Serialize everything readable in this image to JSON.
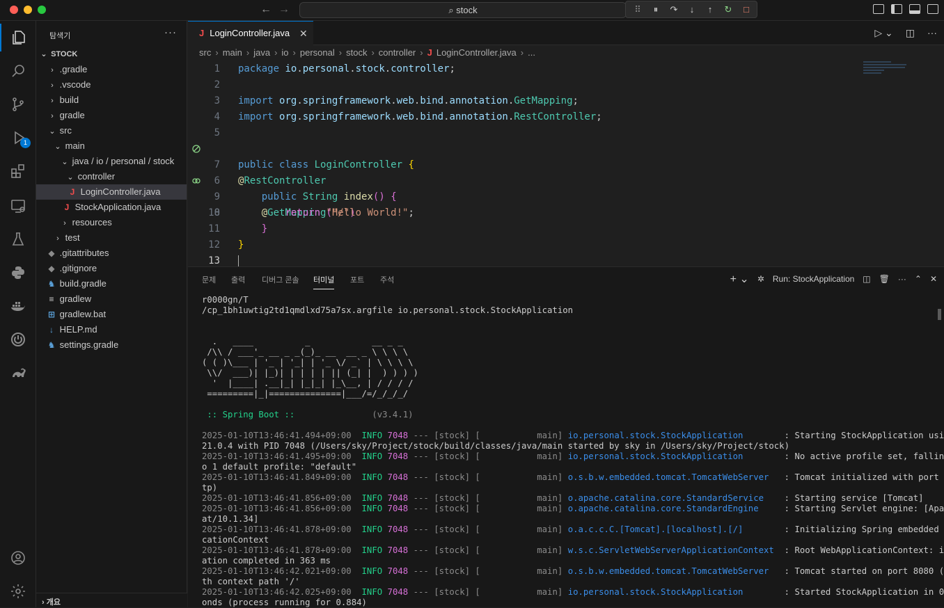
{
  "titlebar": {
    "search_text": "stock",
    "colors": {
      "close": "#ff5f57",
      "minimize": "#febc2e",
      "maximize": "#28c840"
    }
  },
  "activity": {
    "debug_badge": "1"
  },
  "sidebar": {
    "title": "탐색기",
    "more": "···",
    "root": "STOCK",
    "items": [
      {
        "label": ".gradle"
      },
      {
        "label": ".vscode"
      },
      {
        "label": "build"
      },
      {
        "label": "gradle"
      },
      {
        "label": "src"
      },
      {
        "label": "main"
      },
      {
        "label": "java / io / personal / stock"
      },
      {
        "label": "controller"
      },
      {
        "label": "LoginController.java"
      },
      {
        "label": "StockApplication.java"
      },
      {
        "label": "resources"
      },
      {
        "label": "test"
      },
      {
        "label": ".gitattributes"
      },
      {
        "label": ".gitignore"
      },
      {
        "label": "build.gradle"
      },
      {
        "label": "gradlew"
      },
      {
        "label": "gradlew.bat"
      },
      {
        "label": "HELP.md"
      },
      {
        "label": "settings.gradle"
      }
    ],
    "outline": "개요"
  },
  "editor": {
    "tab_label": "LoginController.java",
    "breadcrumb": [
      "src",
      "main",
      "java",
      "io",
      "personal",
      "stock",
      "controller",
      "LoginController.java",
      "..."
    ],
    "line_numbers": [
      "1",
      "2",
      "3",
      "4",
      "5",
      "6",
      "7",
      "8",
      "9",
      "10",
      "11",
      "12",
      "13"
    ]
  },
  "panel": {
    "tabs": [
      "문제",
      "출력",
      "디버그 콘솔",
      "터미널",
      "포트",
      "주석"
    ],
    "run_label": "Run: StockApplication",
    "terminal": {
      "pre": [
        "r0000gn/T",
        "/cp_1bh1uwtig2td1qmdlxd75a7sx.argfile io.personal.stock.StockApplication"
      ],
      "banner": [
        "  .   ____          _            __ _ _",
        " /\\\\ / ___'_ __ _ _(_)_ __  __ _ \\ \\ \\ \\",
        "( ( )\\___ | '_ | '_| | '_ \\/ _` | \\ \\ \\ \\",
        " \\\\/  ___)| |_)| | | | | || (_| |  ) ) ) )",
        "  '  |____| .__|_| |_|_| |_\\__, | / / / /",
        " =========|_|==============|___/=/_/_/_/"
      ],
      "boot_label": " :: Spring Boot :: ",
      "boot_version": "              (v3.4.1)",
      "logs": [
        {
          "ts": "2025-01-10T13:46:41.494+09:00",
          "level": "INFO",
          "pid": "7048",
          "mid": "--- [stock] [           main] ",
          "logger": "io.personal.stock.StockApplication       ",
          "blue": true,
          "msg": ": Starting StockApplication using Java",
          "cont": "21.0.4 with PID 7048 (/Users/sky/Project/stock/build/classes/java/main started by sky in /Users/sky/Project/stock)"
        },
        {
          "ts": "2025-01-10T13:46:41.495+09:00",
          "level": "INFO",
          "pid": "7048",
          "mid": "--- [stock] [           main] ",
          "logger": "io.personal.stock.StockApplication       ",
          "blue": true,
          "msg": ": No active profile set, falling back t",
          "cont": "o 1 default profile: \"default\""
        },
        {
          "ts": "2025-01-10T13:46:41.849+09:00",
          "level": "INFO",
          "pid": "7048",
          "mid": "--- [stock] [           main] ",
          "logger": "o.s.b.w.embedded.tomcat.TomcatWebServer  ",
          "blue": false,
          "msg": ": Tomcat initialized with port 8080 (ht",
          "cont": "tp)"
        },
        {
          "ts": "2025-01-10T13:46:41.856+09:00",
          "level": "INFO",
          "pid": "7048",
          "mid": "--- [stock] [           main] ",
          "logger": "o.apache.catalina.core.StandardService   ",
          "blue": false,
          "msg": ": Starting service [Tomcat]",
          "cont": ""
        },
        {
          "ts": "2025-01-10T13:46:41.856+09:00",
          "level": "INFO",
          "pid": "7048",
          "mid": "--- [stock] [           main] ",
          "logger": "o.apache.catalina.core.StandardEngine    ",
          "blue": false,
          "msg": ": Starting Servlet engine: [Apache Tomc",
          "cont": "at/10.1.34]"
        },
        {
          "ts": "2025-01-10T13:46:41.878+09:00",
          "level": "INFO",
          "pid": "7048",
          "mid": "--- [stock] [           main] ",
          "logger": "o.a.c.c.C.[Tomcat].[localhost].[/]       ",
          "blue": false,
          "msg": ": Initializing Spring embedded WebAppli",
          "cont": "cationContext"
        },
        {
          "ts": "2025-01-10T13:46:41.878+09:00",
          "level": "INFO",
          "pid": "7048",
          "mid": "--- [stock] [           main] ",
          "logger": "w.s.c.ServletWebServerApplicationContext ",
          "blue": false,
          "msg": ": Root WebApplicationContext: initializ",
          "cont": "ation completed in 363 ms"
        },
        {
          "ts": "2025-01-10T13:46:42.021+09:00",
          "level": "INFO",
          "pid": "7048",
          "mid": "--- [stock] [           main] ",
          "logger": "o.s.b.w.embedded.tomcat.TomcatWebServer  ",
          "blue": false,
          "msg": ": Tomcat started on port 8080 (http) wi",
          "cont": "th context path '/'"
        },
        {
          "ts": "2025-01-10T13:46:42.025+09:00",
          "level": "INFO",
          "pid": "7048",
          "mid": "--- [stock] [           main] ",
          "logger": "io.personal.stock.StockApplication       ",
          "blue": true,
          "msg": ": Started StockApplication in 0.701 sec",
          "cont": "onds (process running for 0.884)"
        }
      ]
    }
  }
}
